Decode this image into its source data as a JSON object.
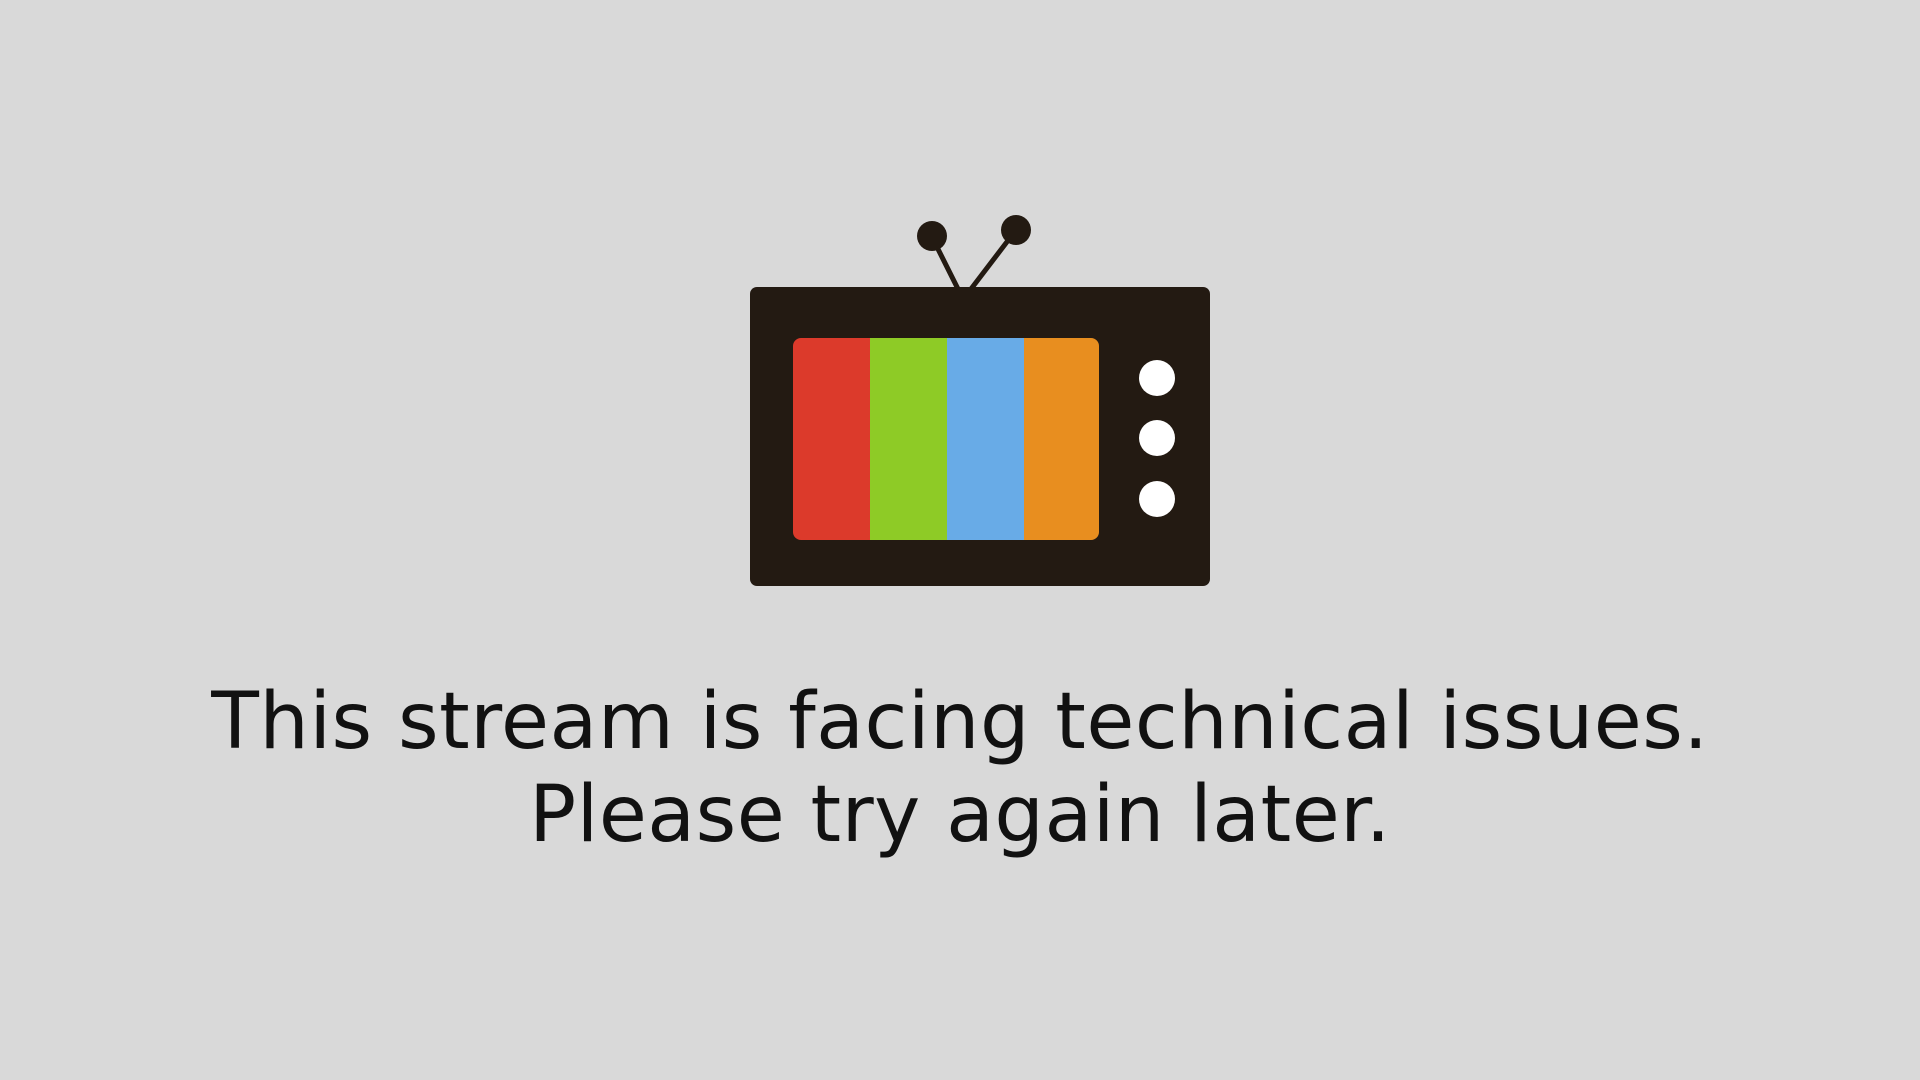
{
  "message": {
    "line1": "This stream is facing technical issues.",
    "line2": "Please try again later."
  },
  "icon": {
    "name": "tv-icon",
    "colors": {
      "body": "#231a12",
      "bar_red": "#dc3a2b",
      "bar_green": "#8ecb26",
      "bar_blue": "#68abe7",
      "bar_orange": "#e88e1f",
      "knob": "#ffffff"
    }
  },
  "background": "#d9d9d9"
}
